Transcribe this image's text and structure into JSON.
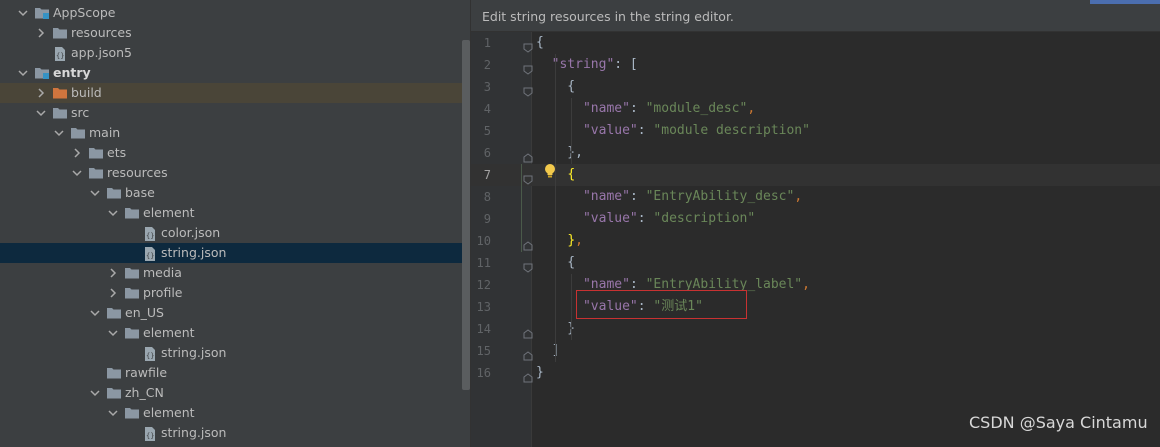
{
  "tree": {
    "rows": [
      {
        "label": "AppScope",
        "depth": 0,
        "expanded": true,
        "icon": "module-folder-icon",
        "bold": false
      },
      {
        "label": "resources",
        "depth": 1,
        "expanded": false,
        "icon": "folder-icon",
        "bold": false
      },
      {
        "label": "app.json5",
        "depth": 1,
        "expanded": null,
        "icon": "json-file-icon",
        "bold": false
      },
      {
        "label": "entry",
        "depth": 0,
        "expanded": true,
        "icon": "module-folder-icon",
        "bold": true
      },
      {
        "label": "build",
        "depth": 1,
        "expanded": false,
        "icon": "build-folder-icon",
        "bold": false,
        "state": "excluded"
      },
      {
        "label": "src",
        "depth": 1,
        "expanded": true,
        "icon": "folder-icon",
        "bold": false
      },
      {
        "label": "main",
        "depth": 2,
        "expanded": true,
        "icon": "folder-icon",
        "bold": false
      },
      {
        "label": "ets",
        "depth": 3,
        "expanded": false,
        "icon": "folder-icon",
        "bold": false
      },
      {
        "label": "resources",
        "depth": 3,
        "expanded": true,
        "icon": "folder-icon",
        "bold": false
      },
      {
        "label": "base",
        "depth": 4,
        "expanded": true,
        "icon": "folder-icon",
        "bold": false
      },
      {
        "label": "element",
        "depth": 5,
        "expanded": true,
        "icon": "folder-icon",
        "bold": false
      },
      {
        "label": "color.json",
        "depth": 6,
        "expanded": null,
        "icon": "json-file-icon",
        "bold": false
      },
      {
        "label": "string.json",
        "depth": 6,
        "expanded": null,
        "icon": "json-file-icon",
        "bold": false,
        "state": "selected"
      },
      {
        "label": "media",
        "depth": 5,
        "expanded": false,
        "icon": "folder-icon",
        "bold": false
      },
      {
        "label": "profile",
        "depth": 5,
        "expanded": false,
        "icon": "folder-icon",
        "bold": false
      },
      {
        "label": "en_US",
        "depth": 4,
        "expanded": true,
        "icon": "folder-icon",
        "bold": false
      },
      {
        "label": "element",
        "depth": 5,
        "expanded": true,
        "icon": "folder-icon",
        "bold": false
      },
      {
        "label": "string.json",
        "depth": 6,
        "expanded": null,
        "icon": "json-file-icon",
        "bold": false
      },
      {
        "label": "rawfile",
        "depth": 4,
        "expanded": null,
        "icon": "folder-icon",
        "bold": false
      },
      {
        "label": "zh_CN",
        "depth": 4,
        "expanded": true,
        "icon": "folder-icon",
        "bold": false
      },
      {
        "label": "element",
        "depth": 5,
        "expanded": true,
        "icon": "folder-icon",
        "bold": false
      },
      {
        "label": "string.json",
        "depth": 6,
        "expanded": null,
        "icon": "json-file-icon",
        "bold": false
      }
    ]
  },
  "editor": {
    "banner": "Edit string resources in the string editor.",
    "current_line": 7,
    "lines": [
      {
        "n": "1",
        "code": [
          [
            "b",
            "{"
          ]
        ]
      },
      {
        "n": "2",
        "code": [
          [
            "b",
            "  "
          ],
          [
            "k",
            "\"string\""
          ],
          [
            "b",
            ": ["
          ]
        ]
      },
      {
        "n": "3",
        "code": [
          [
            "b",
            "    {"
          ]
        ]
      },
      {
        "n": "4",
        "code": [
          [
            "b",
            "      "
          ],
          [
            "k",
            "\"name\""
          ],
          [
            "b",
            ": "
          ],
          [
            "s",
            "\"module_desc\""
          ],
          [
            "p",
            ","
          ]
        ]
      },
      {
        "n": "5",
        "code": [
          [
            "b",
            "      "
          ],
          [
            "k",
            "\"value\""
          ],
          [
            "b",
            ": "
          ],
          [
            "s",
            "\"module description\""
          ]
        ]
      },
      {
        "n": "6",
        "code": [
          [
            "b",
            "    },"
          ]
        ]
      },
      {
        "n": "7",
        "code": [
          [
            "b",
            "    "
          ],
          [
            "bm",
            "{"
          ]
        ]
      },
      {
        "n": "8",
        "code": [
          [
            "b",
            "      "
          ],
          [
            "k",
            "\"name\""
          ],
          [
            "b",
            ": "
          ],
          [
            "s",
            "\"EntryAbility_desc\""
          ],
          [
            "p",
            ","
          ]
        ]
      },
      {
        "n": "9",
        "code": [
          [
            "b",
            "      "
          ],
          [
            "k",
            "\"value\""
          ],
          [
            "b",
            ": "
          ],
          [
            "s",
            "\"description\""
          ]
        ]
      },
      {
        "n": "10",
        "code": [
          [
            "b",
            "    "
          ],
          [
            "bm",
            "}"
          ],
          [
            "p",
            ","
          ]
        ]
      },
      {
        "n": "11",
        "code": [
          [
            "b",
            "    {"
          ]
        ]
      },
      {
        "n": "12",
        "code": [
          [
            "b",
            "      "
          ],
          [
            "k",
            "\"name\""
          ],
          [
            "b",
            ": "
          ],
          [
            "s",
            "\"EntryAbility_label\""
          ],
          [
            "p",
            ","
          ]
        ]
      },
      {
        "n": "13",
        "code": [
          [
            "b",
            "      "
          ],
          [
            "k",
            "\"value\""
          ],
          [
            "b",
            ": "
          ],
          [
            "s",
            "\"测试1\""
          ]
        ]
      },
      {
        "n": "14",
        "code": [
          [
            "b",
            "    }"
          ]
        ]
      },
      {
        "n": "15",
        "code": [
          [
            "b",
            "  ]"
          ]
        ]
      },
      {
        "n": "16",
        "code": [
          [
            "b",
            "}"
          ]
        ]
      }
    ]
  },
  "watermark": "CSDN @Saya Cintamu",
  "colors": {
    "panel": "#3c3f41",
    "editor": "#2b2b2b",
    "selection": "#0d293e",
    "excluded": "#4a4538",
    "highlight_box": "#c83232"
  }
}
